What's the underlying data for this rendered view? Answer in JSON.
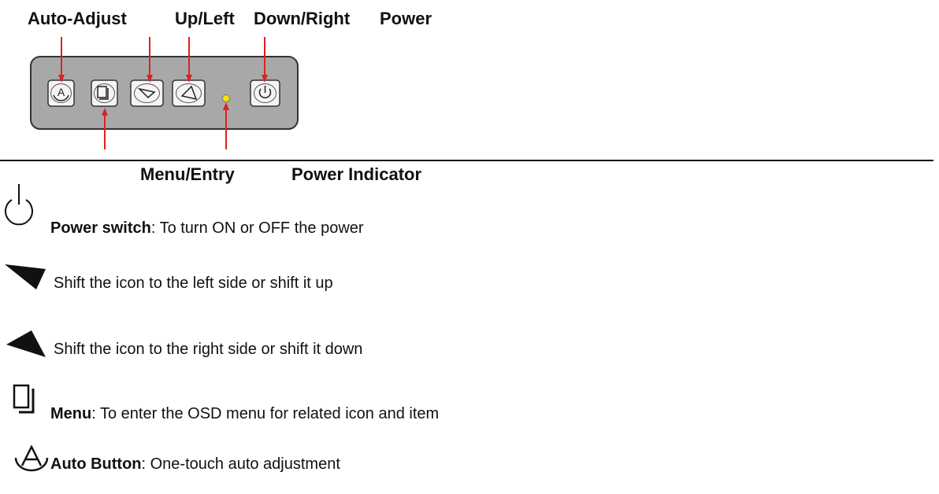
{
  "labels": {
    "auto_adjust": "Auto-Adjust",
    "up_left": "Up/Left",
    "down_right": "Down/Right",
    "power": "Power",
    "menu_entry": "Menu/Entry",
    "power_indicator": "Power Indicator"
  },
  "panel": {
    "buttons": [
      "auto-button",
      "menu-button",
      "up-left-button",
      "down-right-button",
      "power-button"
    ],
    "indicator_color": "#f5e600",
    "arrow_color": "#e02020",
    "panel_color": "#a8a8a8"
  },
  "legend": [
    {
      "icon": "power-icon",
      "bold": "Power switch",
      "text": ": To turn ON or OFF the power"
    },
    {
      "icon": "left-up-arrow-icon",
      "bold": "",
      "text": "Shift the icon to the left side or shift it up"
    },
    {
      "icon": "right-down-arrow-icon",
      "bold": "",
      "text": "Shift the icon to the right side or shift it down"
    },
    {
      "icon": "menu-icon",
      "bold": "Menu",
      "text": ": To enter the OSD menu for related icon and item"
    },
    {
      "icon": "auto-icon",
      "bold": "Auto Button",
      "text": ": One-touch auto adjustment"
    }
  ]
}
